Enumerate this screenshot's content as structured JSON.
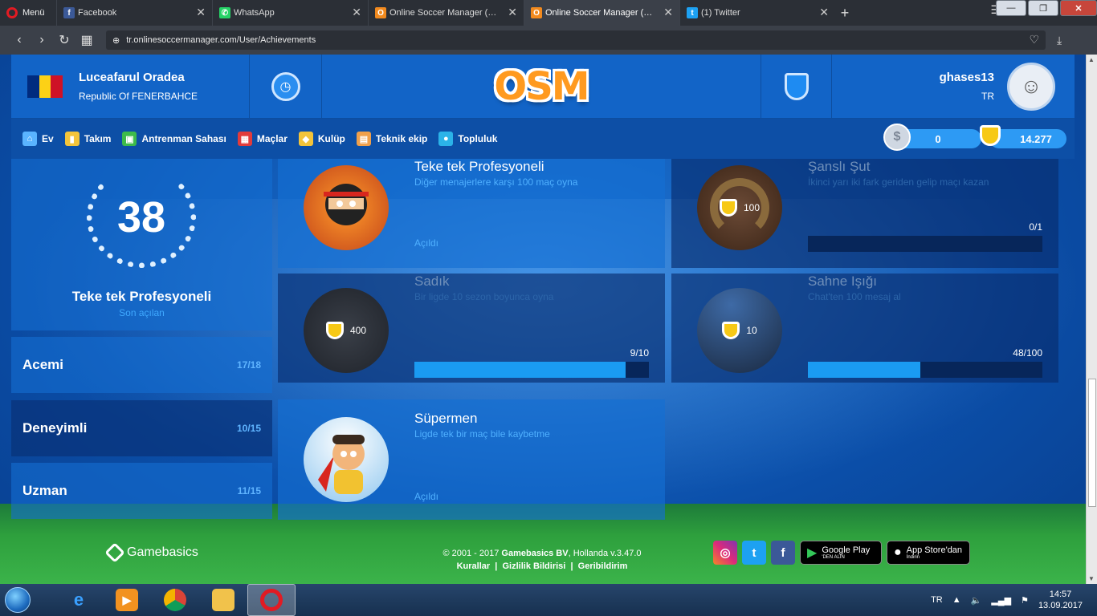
{
  "browser": {
    "menu_label": "Menü",
    "tabs": [
      {
        "title": "Facebook",
        "icon": "facebook-icon",
        "color": "#3b5998",
        "glyph": "f"
      },
      {
        "title": "WhatsApp",
        "icon": "whatsapp-icon",
        "color": "#25d366",
        "glyph": "✆"
      },
      {
        "title": "Online Soccer Manager (OSM) -",
        "icon": "osm-icon",
        "color": "#f28a1e",
        "glyph": "O"
      },
      {
        "title": "Online Soccer Manager (OSM) -",
        "icon": "osm-icon",
        "color": "#f28a1e",
        "glyph": "O"
      },
      {
        "title": "(1) Twitter",
        "icon": "twitter-icon",
        "color": "#1da1f2",
        "glyph": "t"
      }
    ],
    "url": "tr.onlinesoccermanager.com/User/Achievements"
  },
  "header": {
    "club_name": "Luceafarul Oradea",
    "club_sub": "Republic Of FENERBAHCE",
    "flag_colors": [
      "#002b7f",
      "#fcd116",
      "#ce1126"
    ],
    "logo_text": "OSM",
    "username": "ghases13",
    "user_country": "TR"
  },
  "nav": {
    "items": [
      {
        "label": "Ev",
        "icon": "home-icon",
        "color": "#5ab4ff",
        "glyph": "⌂"
      },
      {
        "label": "Takım",
        "icon": "shirt-icon",
        "color": "#f3c43a",
        "glyph": "▮"
      },
      {
        "label": "Antrenman Sahası",
        "icon": "training-field-icon",
        "color": "#3dbb4a",
        "glyph": "▣"
      },
      {
        "label": "Maçlar",
        "icon": "calendar-icon",
        "color": "#e23b3b",
        "glyph": "▦"
      },
      {
        "label": "Kulüp",
        "icon": "club-shield-icon",
        "color": "#f3c43a",
        "glyph": "◆"
      },
      {
        "label": "Teknik ekip",
        "icon": "staff-board-icon",
        "color": "#f0a04b",
        "glyph": "▤"
      },
      {
        "label": "Topluluk",
        "icon": "globe-icon",
        "color": "#2bb3e8",
        "glyph": "●"
      }
    ],
    "savings": "0",
    "credits": "14.277"
  },
  "trophy": {
    "count": "38",
    "title": "Teke tek Profesyoneli",
    "subtitle": "Son açılan"
  },
  "levels": [
    {
      "name": "Acemi",
      "count": "17/18"
    },
    {
      "name": "Deneyimli",
      "count": "10/15"
    },
    {
      "name": "Uzman",
      "count": "11/15"
    }
  ],
  "achievements": [
    {
      "title": "Teke tek Profesyoneli",
      "desc": "Diğer menajerlere karşı 100 maç oyna",
      "status": "Açıldı",
      "unlocked": true,
      "art": "ninja"
    },
    {
      "title": "Şanslı Şut",
      "desc": "İkinci yarı iki fark geriden gelip maçı kazan",
      "reward": "100",
      "progress_label": "0/1",
      "progress": 0.0,
      "unlocked": false,
      "art": "horseshoe"
    },
    {
      "title": "Sadık",
      "desc": "Bir ligde 10 sezon boyunca oyna",
      "reward": "400",
      "progress_label": "9/10",
      "progress": 0.9,
      "unlocked": false,
      "art": "ghost"
    },
    {
      "title": "Sahne Işığı",
      "desc": "Chat'ten 100 mesaj al",
      "reward": "10",
      "progress_label": "48/100",
      "progress": 0.48,
      "unlocked": false,
      "art": "spotlight"
    },
    {
      "title": "Süpermen",
      "desc": "Ligde tek bir maç bile kaybetme",
      "status": "Açıldı",
      "unlocked": true,
      "art": "superman"
    }
  ],
  "footer": {
    "brand": "Gamebasics",
    "copyright_prefix": "© 2001 - 2017 ",
    "copyright_company": "Gamebasics BV",
    "copyright_suffix": ", Hollanda v.3.47.0",
    "links": [
      "Kurallar",
      "Gizlilik Bildirisi",
      "Geribildirim"
    ],
    "google_play": {
      "line1": "Google Play",
      "line2": "'DEN ALIN"
    },
    "app_store": {
      "line1": "App Store'dan",
      "line2": "İndirin"
    }
  },
  "taskbar": {
    "language": "TR",
    "time": "14:57",
    "date": "13.09.2017"
  }
}
